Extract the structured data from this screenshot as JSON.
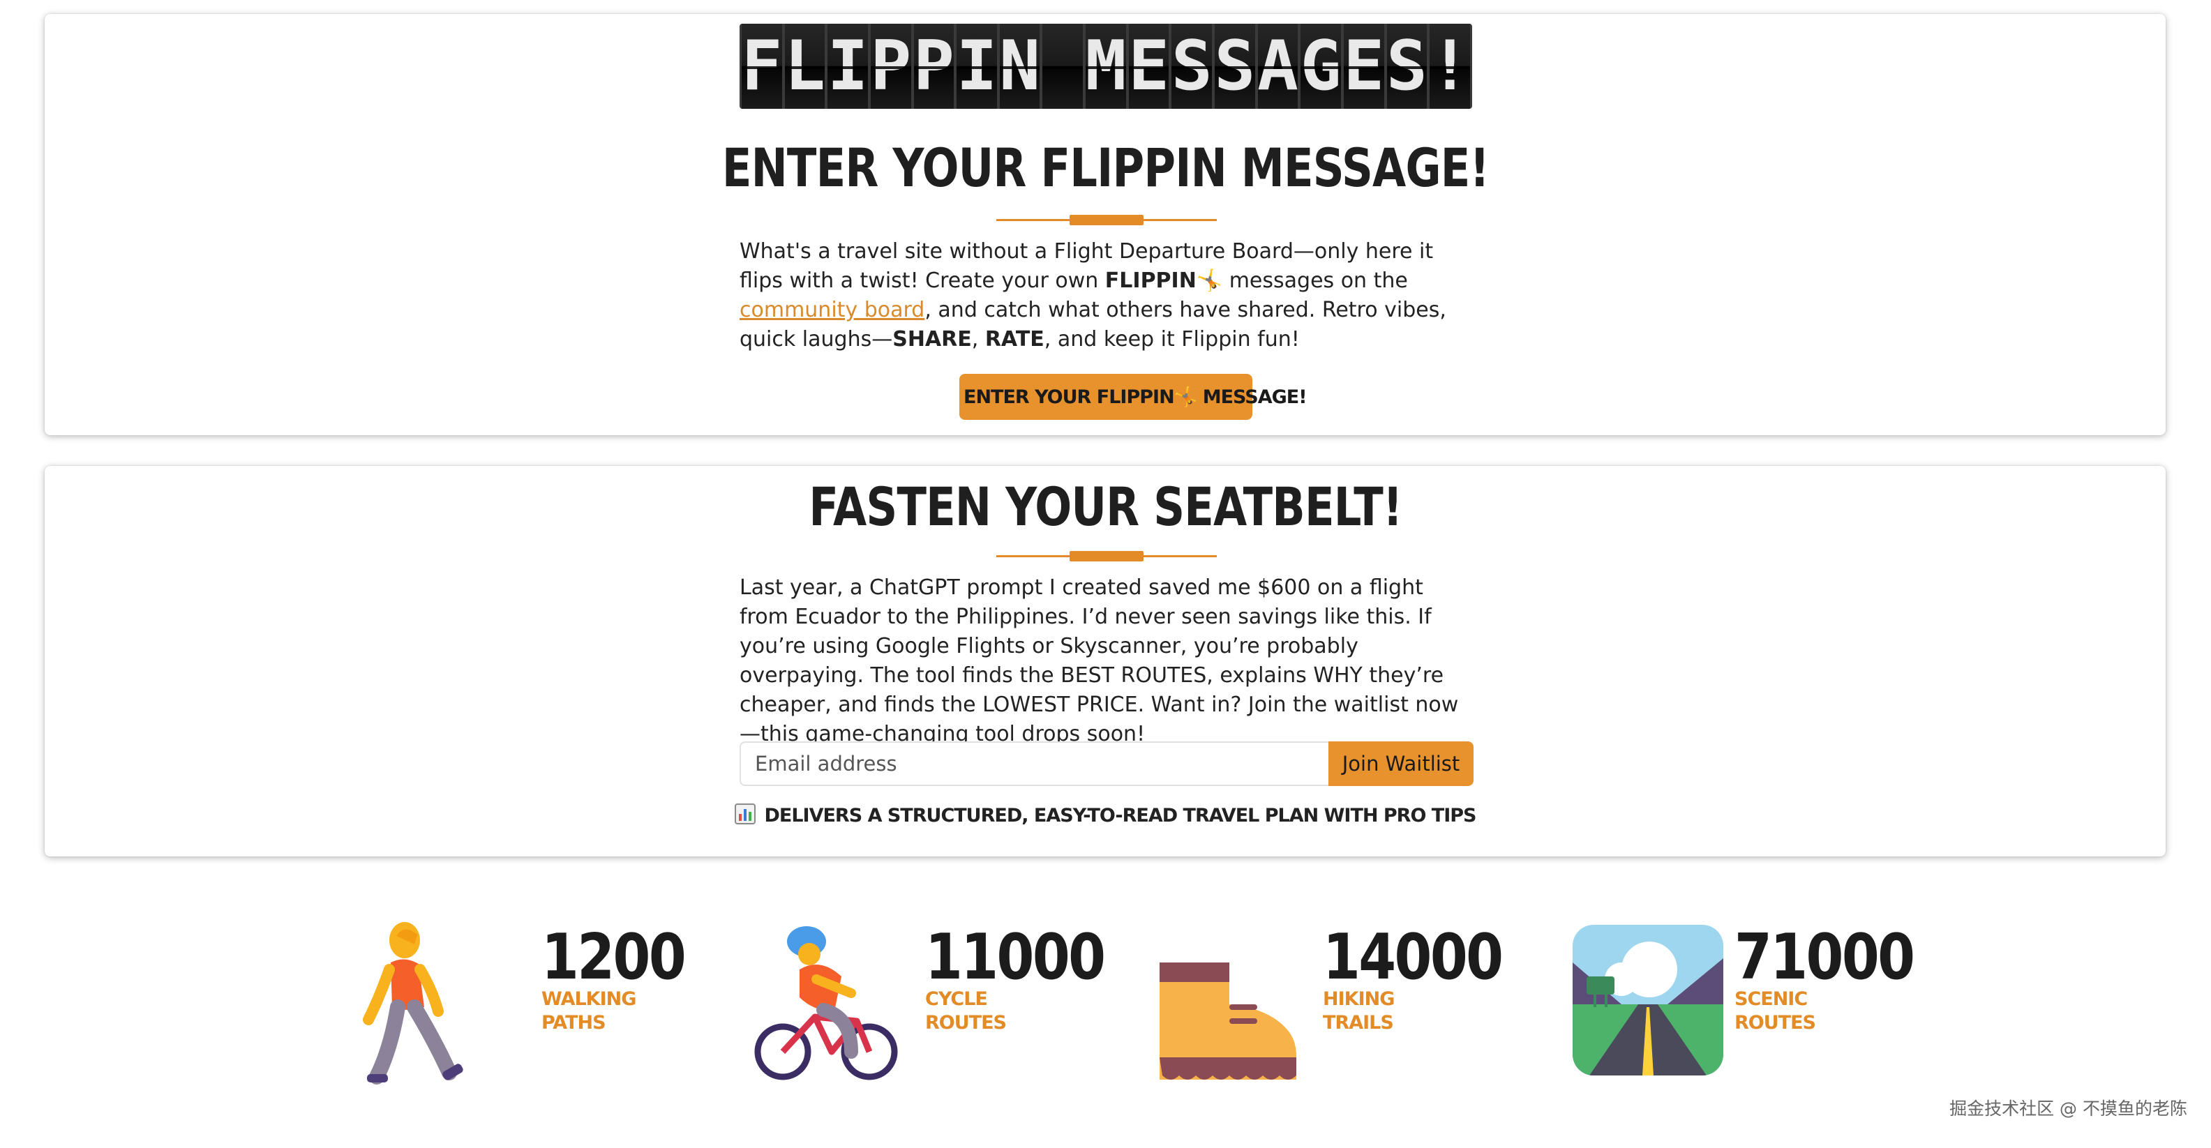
{
  "logo": {
    "letters": [
      "F",
      "L",
      "I",
      "P",
      "P",
      "I",
      "N",
      " ",
      "M",
      "E",
      "S",
      "S",
      "A",
      "G",
      "E",
      "S",
      "!"
    ]
  },
  "section1": {
    "title": "ENTER YOUR FLIPPIN MESSAGE!",
    "paragraph": {
      "t1": "What's a travel site without a Flight Departure Board—only here it flips with a twist! Create your own ",
      "b1": "FLIPPIN",
      "emoji": "🤸",
      "t2": " messages on the ",
      "link": "community board",
      "t3": ", and catch what others have shared. Retro vibes, quick laughs—",
      "b2": "SHARE",
      "t4": ", ",
      "b3": "RATE",
      "t5": ", and keep it Flippin fun!"
    },
    "cta": {
      "pre": "ENTER YOUR FLIPPIN",
      "emoji": "🤸",
      "post": " MESSAGE!"
    }
  },
  "section2": {
    "title": "FASTEN YOUR SEATBELT!",
    "paragraph": "Last year, a ChatGPT prompt I created saved me $600 on a flight from Ecuador to the Philippines. I’d never seen savings like this. If you’re using Google Flights or Skyscanner, you’re probably overpaying. The tool finds the BEST ROUTES, explains WHY they’re cheaper, and finds the LOWEST PRICE. Want in? Join the waitlist now—this game-changing tool drops soon!",
    "email_placeholder": "Email address",
    "join_label": "Join Waitlist",
    "tip_icon": "bar-chart-icon",
    "tip": "DELIVERS A STRUCTURED, EASY-TO-READ TRAVEL PLAN WITH PRO TIPS"
  },
  "stats": [
    {
      "icon": "walking-person-icon",
      "number": "1200",
      "label": "WALKING PATHS"
    },
    {
      "icon": "cyclist-icon",
      "number": "11000",
      "label": "CYCLE ROUTES"
    },
    {
      "icon": "hiking-boot-icon",
      "number": "14000",
      "label": "HIKING TRAILS"
    },
    {
      "icon": "scenic-road-icon",
      "number": "71000",
      "label": "SCENIC ROUTES"
    }
  ],
  "watermark": "掘金技术社区 @ 不摸鱼的老陈",
  "colors": {
    "accent": "#e8922e",
    "text": "#212121",
    "flap": "#1a1a1a"
  }
}
